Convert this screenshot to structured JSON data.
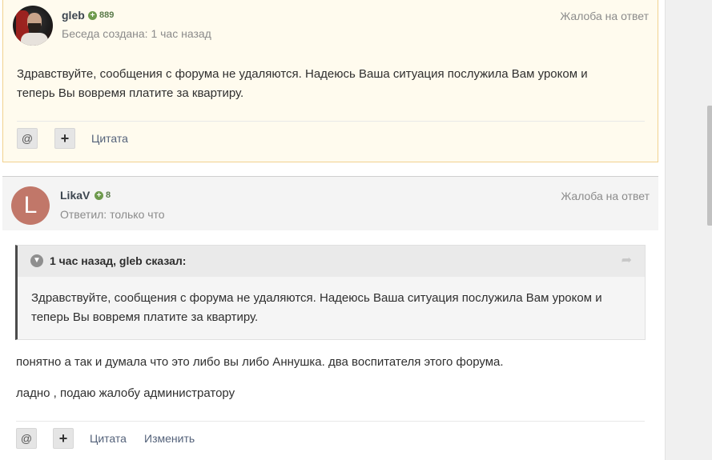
{
  "post1": {
    "author": "gleb",
    "reputation": "889",
    "meta": "Беседа создана: 1 час назад",
    "report": "Жалоба на ответ",
    "body_line1": "Здравствуйте, сообщения с форума не удаляются. Надеюсь Ваша ситуация послужила Вам уроком и",
    "body_line2": "теперь Вы вовремя платите за квартиру.",
    "controls": {
      "mention": "@",
      "add": "+",
      "quote": "Цитата"
    }
  },
  "post2": {
    "author": "LikaV",
    "avatar_letter": "L",
    "reputation": "8",
    "meta": "Ответил: только что",
    "report": "Жалоба на ответ",
    "quote": {
      "cite": "1 час назад, gleb сказал:",
      "line1": "Здравствуйте, сообщения с форума не удаляются. Надеюсь Ваша ситуация послужила Вам уроком и",
      "line2": "теперь Вы вовремя платите за квартиру."
    },
    "paragraph1": "понятно а так и думала что это либо вы либо Аннушка. два воспитателя этого форума.",
    "paragraph2": "ладно , подаю жалобу администратору",
    "controls": {
      "mention": "@",
      "add": "+",
      "quote": "Цитата",
      "edit": "Изменить"
    }
  },
  "icons": {
    "reputation": "plus-circle-icon",
    "quote_toggle": "chevron-down-icon",
    "quote_share": "share-arrow-icon"
  },
  "colors": {
    "highlight_bg": "#fffbee",
    "highlight_border": "#f1d28f",
    "reputation": "#6e9a4d",
    "avatar2_bg": "#c17769",
    "link": "#54627a"
  }
}
